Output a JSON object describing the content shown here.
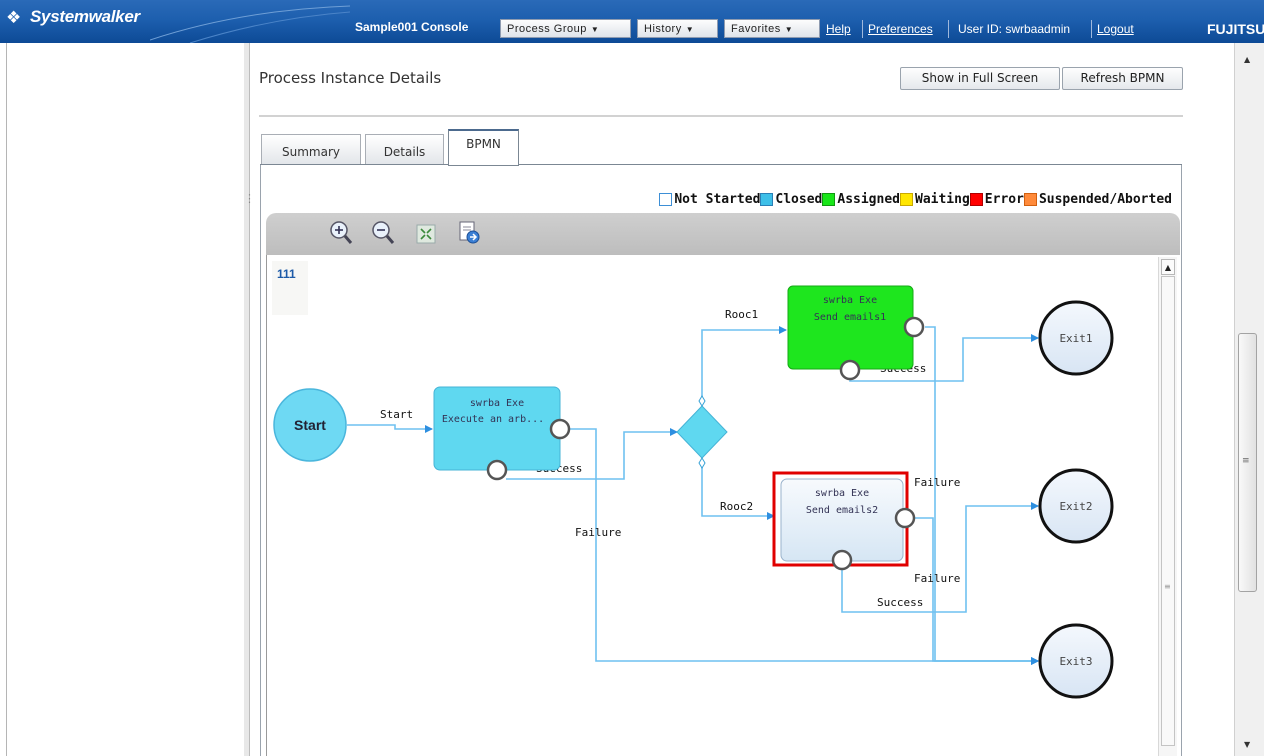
{
  "header": {
    "brand": "Systemwalker",
    "console_title": "Sample001 Console",
    "menus": [
      {
        "label": "Process Group"
      },
      {
        "label": "History"
      },
      {
        "label": "Favorites"
      }
    ],
    "help": "Help",
    "preferences": "Preferences",
    "user": "User ID: swrbaadmin",
    "logout": "Logout",
    "vendor": "FUJITSU"
  },
  "page": {
    "title": "Process Instance Details",
    "full_screen_label": "Show in Full Screen",
    "refresh_label": "Refresh BPMN"
  },
  "tabs": [
    {
      "label": "Summary",
      "active": false
    },
    {
      "label": "Details",
      "active": false
    },
    {
      "label": "BPMN",
      "active": true
    }
  ],
  "legend": [
    {
      "label": "Not Started",
      "color": "#ffffff",
      "border": "#3d8fd6"
    },
    {
      "label": "Closed",
      "color": "#3dbfe8",
      "border": "#2a7fb6"
    },
    {
      "label": "Assigned",
      "color": "#19e619",
      "border": "#119911"
    },
    {
      "label": "Waiting",
      "color": "#ffe600",
      "border": "#c9a800"
    },
    {
      "label": "Error",
      "color": "#ff0000",
      "border": "#b00000"
    },
    {
      "label": "Suspended/Aborted",
      "color": "#ff8a3a",
      "border": "#d2600f"
    }
  ],
  "toolbar": {
    "icons": [
      "zoom-in-icon",
      "zoom-out-icon",
      "fit-to-window-icon",
      "export-icon"
    ]
  },
  "diagram": {
    "id_label": "111",
    "start": {
      "label": "Start"
    },
    "tasks": [
      {
        "line1": "swrba Exe",
        "line2": "Execute an arb...",
        "status": "Closed"
      },
      {
        "line1": "swrba Exe",
        "line2": "Send emails1",
        "status": "Assigned"
      },
      {
        "line1": "swrba Exe",
        "line2": "Send emails2",
        "status": "Error"
      }
    ],
    "exits": [
      {
        "label": "Exit1"
      },
      {
        "label": "Exit2"
      },
      {
        "label": "Exit3"
      }
    ],
    "edge_labels": {
      "start": "Start",
      "success1": "Success",
      "failure1": "Failure",
      "rooc1": "Rooc1",
      "rooc2": "Rooc2",
      "success2": "Success",
      "failure2": "Failure",
      "failure3": "Failure",
      "success3": "Success"
    },
    "colors": {
      "closed_fill": "#5fd8f0",
      "assigned_fill": "#1ee61e",
      "error_border": "#e00000",
      "exit_fill": "#e8f0fa",
      "edge": "#5fb7ea"
    }
  }
}
